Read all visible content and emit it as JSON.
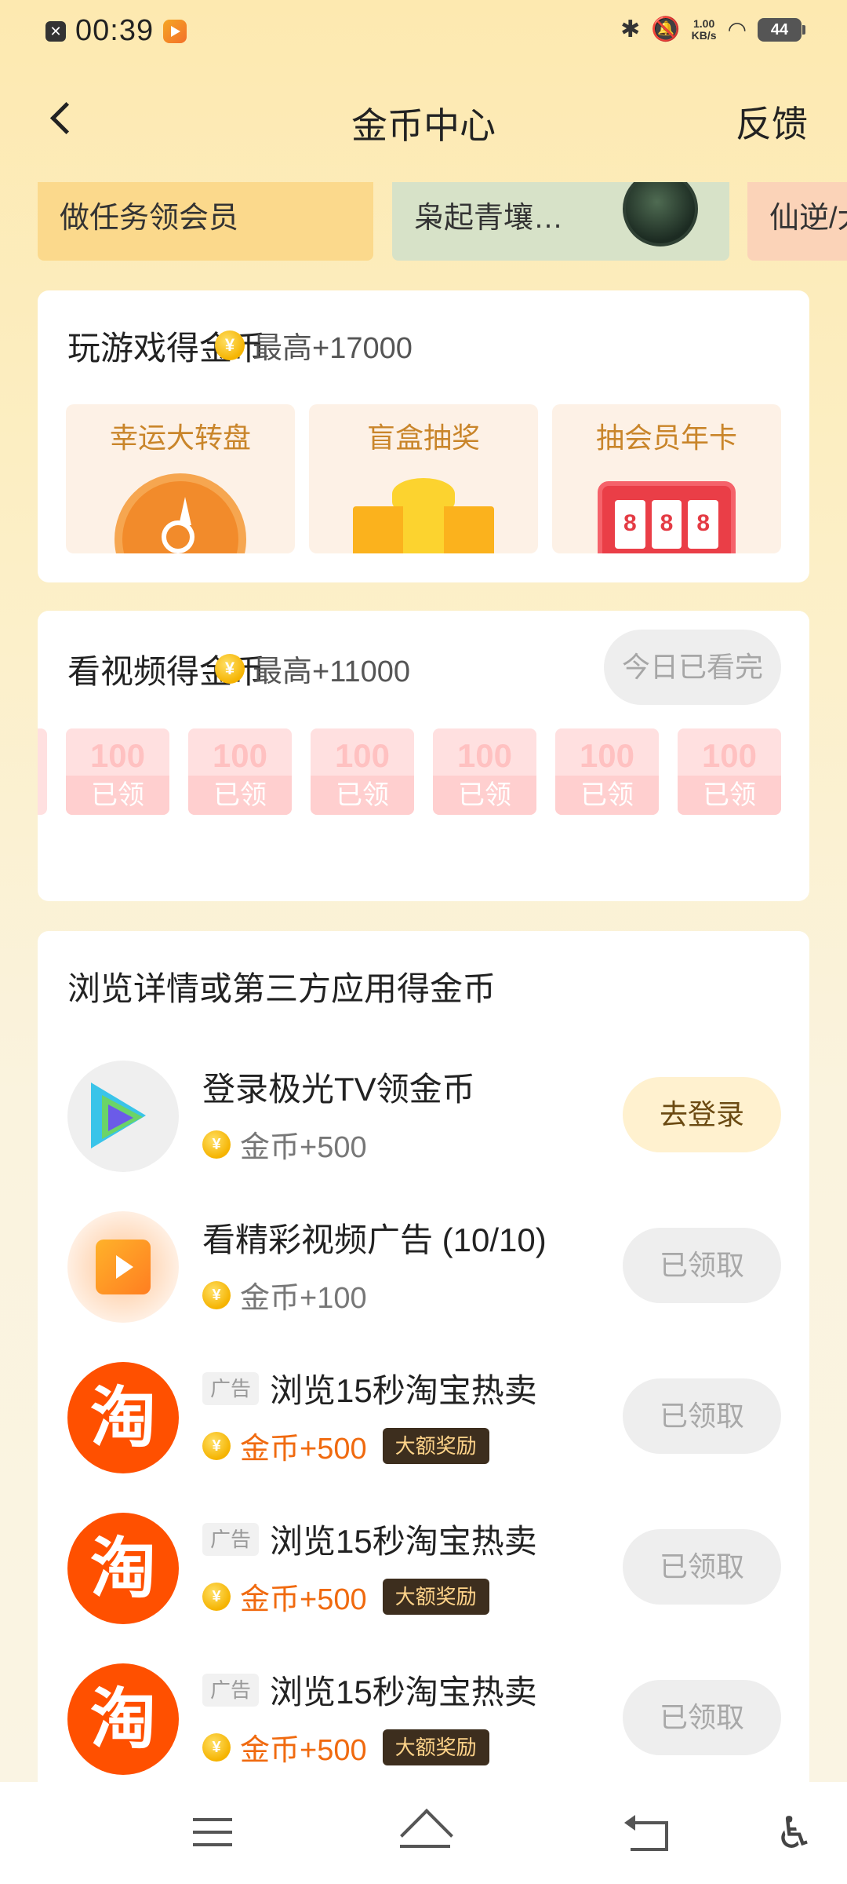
{
  "status_bar": {
    "time": "00:39",
    "speed_top": "1.00",
    "speed_bottom": "KB/s",
    "battery": "44"
  },
  "header": {
    "title": "金币中心",
    "feedback": "反馈"
  },
  "banners": [
    {
      "label": "做任务领会员"
    },
    {
      "label": "枭起青壤…"
    },
    {
      "label": "仙逆/大"
    }
  ],
  "games": {
    "title": "玩游戏得金币",
    "max_reward": "最高+17000",
    "items": [
      {
        "label": "幸运大转盘"
      },
      {
        "label": "盲盒抽奖"
      },
      {
        "label": "抽会员年卡"
      }
    ],
    "slot_digits": [
      "8",
      "8",
      "8"
    ]
  },
  "videos": {
    "title": "看视频得金币",
    "max_reward": "最高+11000",
    "watched_label": "今日已看完",
    "envelopes": [
      {
        "amount": "100",
        "status": "已领"
      },
      {
        "amount": "100",
        "status": "已领"
      },
      {
        "amount": "100",
        "status": "已领"
      },
      {
        "amount": "100",
        "status": "已领"
      },
      {
        "amount": "100",
        "status": "已领"
      },
      {
        "amount": "100",
        "status": "已领"
      }
    ]
  },
  "browse": {
    "title": "浏览详情或第三方应用得金币",
    "coin_symbol": "¥",
    "tasks": [
      {
        "title": "登录极光TV领金币",
        "reward": "金币+500",
        "button": "去登录"
      },
      {
        "title": "看精彩视频广告 (10/10)",
        "reward": "金币+100",
        "button": "已领取"
      },
      {
        "ad_tag": "广告",
        "title": "浏览15秒淘宝热卖",
        "reward": "金币+500",
        "badge": "大额奖励",
        "button": "已领取",
        "icon_char": "淘"
      },
      {
        "ad_tag": "广告",
        "title": "浏览15秒淘宝热卖",
        "reward": "金币+500",
        "badge": "大额奖励",
        "button": "已领取",
        "icon_char": "淘"
      },
      {
        "ad_tag": "广告",
        "title": "浏览15秒淘宝热卖",
        "reward": "金币+500",
        "badge": "大额奖励",
        "button": "已领取",
        "icon_char": "淘"
      }
    ]
  },
  "colors": {
    "accent_orange": "#f06a0f",
    "taobao": "#ff5000",
    "coin": "#f5b300"
  },
  "icons": [
    "back-icon",
    "bluetooth-icon",
    "mute-icon",
    "wifi-icon",
    "battery-icon",
    "coin-icon",
    "menu-icon",
    "home-icon",
    "nav-back-icon",
    "accessibility-icon"
  ]
}
